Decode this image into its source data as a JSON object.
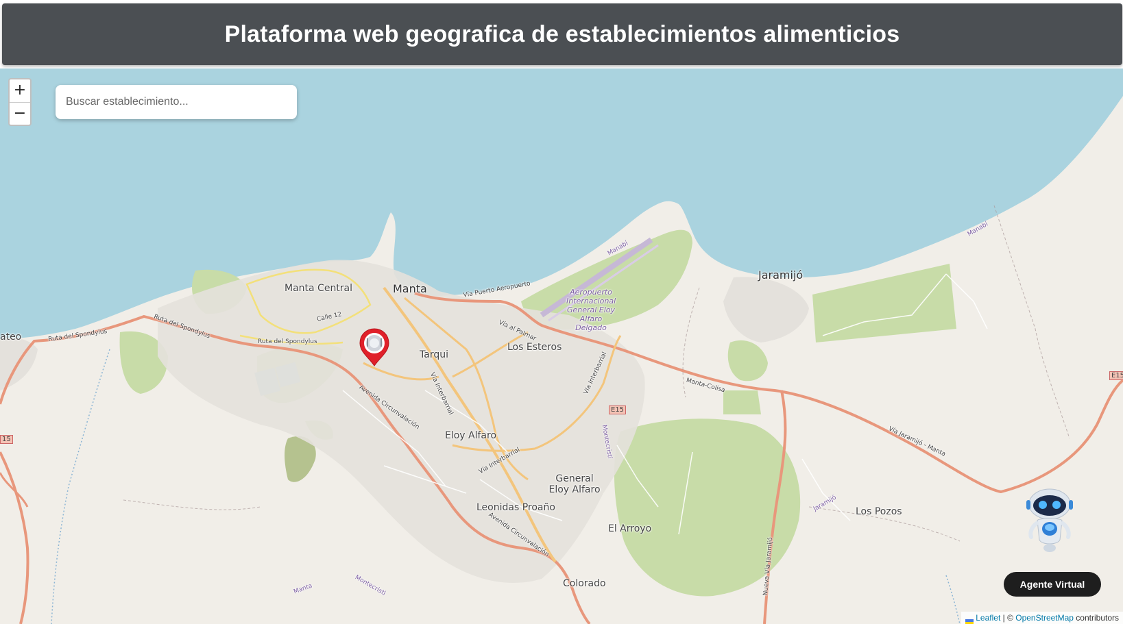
{
  "header": {
    "title": "Plataforma web geografica de establecimientos alimenticios"
  },
  "map": {
    "search_placeholder": "Buscar establecimiento...",
    "zoom_in": "+",
    "zoom_out": "−",
    "place_labels": {
      "manta_central": "Manta Central",
      "manta": "Manta",
      "tarqui": "Tarqui",
      "los_esteros": "Los Esteros",
      "eloy_alfaro": "Eloy Alfaro",
      "general_eloy_alfaro": "General Eloy Alfaro",
      "leonidas_proano": "Leonidas Proaño",
      "el_arroyo": "El Arroyo",
      "colorado": "Colorado",
      "jaramijo": "Jaramijó",
      "los_pozos": "Los Pozos",
      "san_mateo_partial": "ateo",
      "airport": "Aeropuerto Internacional General Eloy Alfaro Delgado"
    },
    "road_labels": {
      "ruta_spondylus_1": "Ruta del Spondylus",
      "ruta_spondylus_2": "Ruta del Spondylus",
      "calle_12": "Calle 12",
      "via_puerto_aeropuerto": "Vía Puerto Aeropuerto",
      "via_al_palmar": "Vía al Palmar",
      "via_interbarrial_1": "Vía Interbarrial",
      "via_interbarrial_2": "Vía Interbarrial",
      "via_interbarrial_3": "Vía Interbarrial",
      "avenida_circunvalacion_1": "Avenida Circunvalación",
      "avenida_circunvalacion_2": "Avenida Circunvalación",
      "manta_colisa": "Manta-Colisa",
      "via_jaramijo_manta": "Vía Jaramijó - Manta",
      "e15_center": "E15",
      "e15_left": "15",
      "e15_right": "E15",
      "manabi_1": "Manabí",
      "manabi_2": "Manabí",
      "nueva_via_jaramijo": "Nueva Vía Jaramijó",
      "jaramijo_road": "Jaramijó",
      "montecristi_1": "Montecristi",
      "montecristi_2": "Montecristi",
      "manta_bottom": "Manta",
      "ruta_spondylus_left": "Ruta del Spondylus"
    },
    "marker_icon": "restaurant-pin-icon"
  },
  "agent": {
    "button_label": "Agente Virtual",
    "icon": "robot-icon"
  },
  "attribution": {
    "leaflet": "Leaflet",
    "separator": " | © ",
    "osm": "OpenStreetMap",
    "contributors": " contributors"
  },
  "colors": {
    "header_bg": "#4b4f53",
    "sea": "#aad3df",
    "land": "#f1eee8",
    "park": "#c8dca8",
    "road_major": "#e89a80",
    "road_secondary": "#f5c77e",
    "marker": "#e0202a",
    "agent_button": "#1e1e1e"
  }
}
